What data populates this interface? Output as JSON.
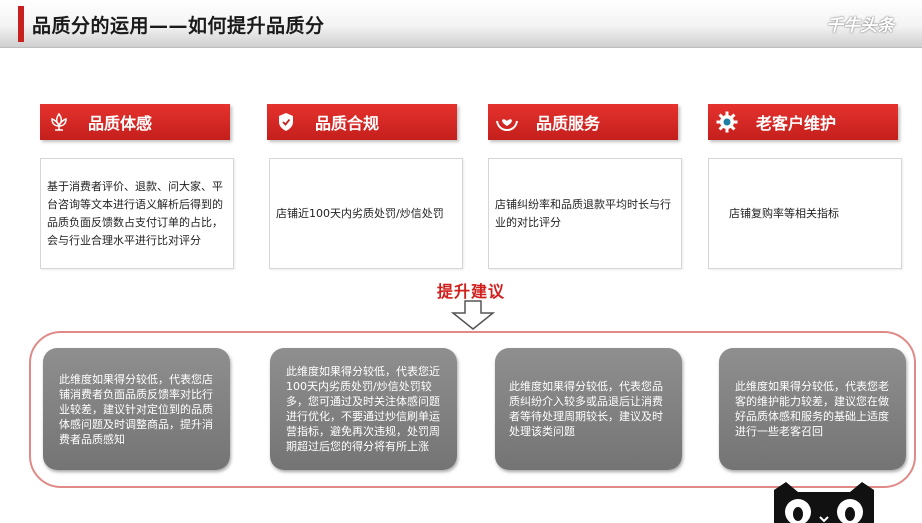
{
  "header": {
    "title": "品质分的运用——如何提升品质分",
    "watermark": "千牛头条"
  },
  "categories": [
    {
      "label": "品质体感",
      "icon": "lotus-icon",
      "description": "基于消费者评价、退款、问大家、平台咨询等文本进行语义解析后得到的品质负面反馈数占支付订单的占比，会与行业合理水平进行比对评分"
    },
    {
      "label": "品质合规",
      "icon": "shield-icon",
      "description": "店铺近100天内劣质处罚/炒信处罚"
    },
    {
      "label": "品质服务",
      "icon": "heart-hands-icon",
      "description": "店铺纠纷率和品质退款平均时长与行业的对比评分"
    },
    {
      "label": "老客户维护",
      "icon": "gear-icon",
      "description": "店铺复购率等相关指标"
    }
  ],
  "suggestion": {
    "label": "提升建议"
  },
  "advice": [
    "此维度如果得分较低，代表您店铺消费者负面品质反馈率对比行业较差，建议针对定位到的品质体感问题及时调整商品，提升消费者品质感知",
    "此维度如果得分较低，代表您近100天内劣质处罚/炒信处罚较多，您可通过及时关注体感问题进行优化，不要通过炒信刷单运营指标，避免再次违规，处罚周期超过后您的得分将有所上涨",
    "此维度如果得分较低，代表您品质纠纷介入较多或品退后让消费者等待处理周期较长，建议及时处理该类问题",
    "此维度如果得分较低，代表您老客的维护能力较差，建议您在做好品质体感和服务的基础上适度进行一些老客召回"
  ],
  "colors": {
    "accent": "#c8201e",
    "header_red": "#d42a26",
    "advice_grey": "#808080",
    "frame_pink": "#e08a88"
  }
}
